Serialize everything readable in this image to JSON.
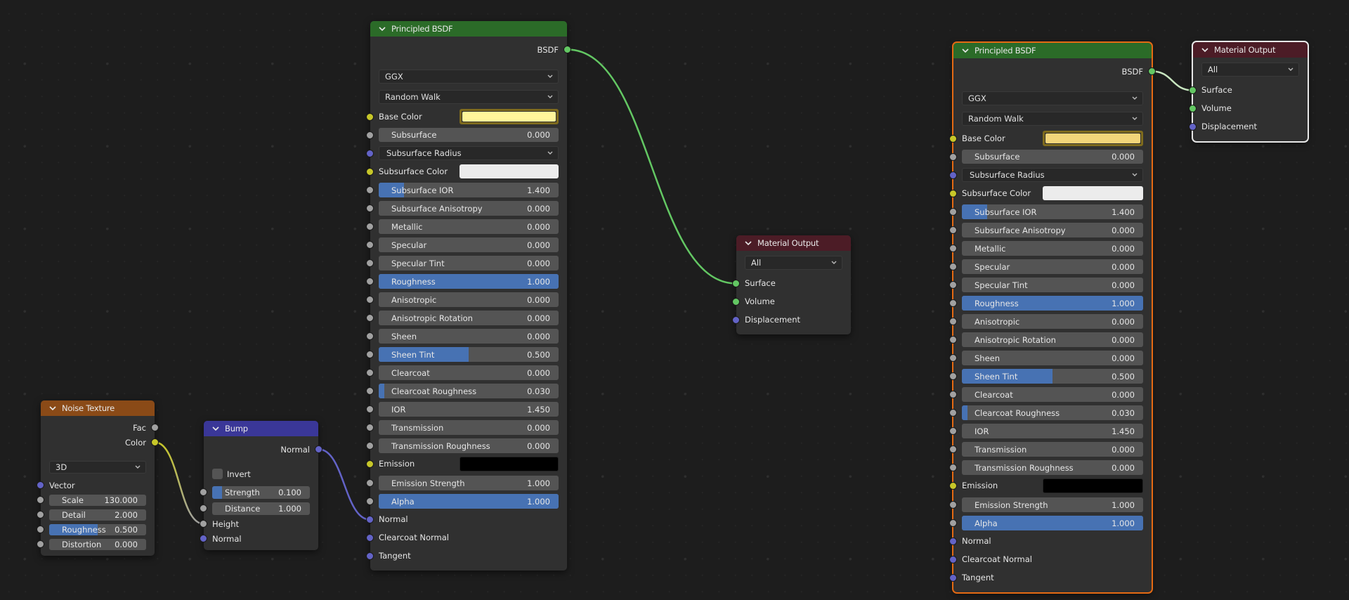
{
  "colors": {
    "background": "#1d1d1d",
    "shader_header": "#2b6b28",
    "output_header": "#4c1c26",
    "texture_header": "#8a4a17",
    "vector_header": "#3a3798",
    "slider_fill": "#4772b3",
    "link_shader": "#63c763",
    "link_vector": "#6363c7",
    "link_color": "#c7c729",
    "selected_outline": "#e56a13"
  },
  "nodes": {
    "noise": {
      "title": "Noise Texture",
      "outputs": [
        "Fac",
        "Color"
      ],
      "dimensions": "3D",
      "vector_label": "Vector",
      "fields": [
        {
          "label": "Scale",
          "value": "130.000",
          "fill": 0
        },
        {
          "label": "Detail",
          "value": "2.000",
          "fill": 0
        },
        {
          "label": "Roughness",
          "value": "0.500",
          "fill": 0.5
        },
        {
          "label": "Distortion",
          "value": "0.000",
          "fill": 0
        }
      ]
    },
    "bump": {
      "title": "Bump",
      "output": "Normal",
      "invert_label": "Invert",
      "invert_checked": false,
      "fields": [
        {
          "label": "Strength",
          "value": "0.100",
          "fill": 0.1
        },
        {
          "label": "Distance",
          "value": "1.000",
          "fill": 0
        }
      ],
      "inputs": [
        "Height",
        "Normal"
      ]
    },
    "bsdf_left": {
      "title": "Principled BSDF",
      "output": "BSDF",
      "distribution": "GGX",
      "subsurface_method": "Random Walk",
      "base_color_label": "Base Color",
      "base_color": "#fff59a",
      "subsurface_label": "Subsurface",
      "subsurface_value": "0.000",
      "subsurface_radius": "Subsurface Radius",
      "subsurface_color_label": "Subsurface Color",
      "subsurface_color": "#ececec",
      "fields": [
        {
          "label": "Subsurface IOR",
          "value": "1.400",
          "fill": 0.14
        },
        {
          "label": "Subsurface Anisotropy",
          "value": "0.000",
          "fill": 0
        },
        {
          "label": "Metallic",
          "value": "0.000",
          "fill": 0
        },
        {
          "label": "Specular",
          "value": "0.000",
          "fill": 0
        },
        {
          "label": "Specular Tint",
          "value": "0.000",
          "fill": 0
        },
        {
          "label": "Roughness",
          "value": "1.000",
          "fill": 1
        },
        {
          "label": "Anisotropic",
          "value": "0.000",
          "fill": 0
        },
        {
          "label": "Anisotropic Rotation",
          "value": "0.000",
          "fill": 0
        },
        {
          "label": "Sheen",
          "value": "0.000",
          "fill": 0
        },
        {
          "label": "Sheen Tint",
          "value": "0.500",
          "fill": 0.5
        },
        {
          "label": "Clearcoat",
          "value": "0.000",
          "fill": 0
        },
        {
          "label": "Clearcoat Roughness",
          "value": "0.030",
          "fill": 0.03
        },
        {
          "label": "IOR",
          "value": "1.450",
          "fill": 0
        },
        {
          "label": "Transmission",
          "value": "0.000",
          "fill": 0
        },
        {
          "label": "Transmission Roughness",
          "value": "0.000",
          "fill": 0
        }
      ],
      "emission_label": "Emission",
      "emission_color": "#000000",
      "fields2": [
        {
          "label": "Emission Strength",
          "value": "1.000",
          "fill": 0
        },
        {
          "label": "Alpha",
          "value": "1.000",
          "fill": 1
        }
      ],
      "vector_inputs": [
        "Normal",
        "Clearcoat Normal",
        "Tangent"
      ]
    },
    "bsdf_right": {
      "title": "Principled BSDF",
      "output": "BSDF",
      "distribution": "GGX",
      "subsurface_method": "Random Walk",
      "base_color_label": "Base Color",
      "base_color": "#f2d57a",
      "subsurface_label": "Subsurface",
      "subsurface_value": "0.000",
      "subsurface_radius": "Subsurface Radius",
      "subsurface_color_label": "Subsurface Color",
      "subsurface_color": "#ececec",
      "fields": [
        {
          "label": "Subsurface IOR",
          "value": "1.400",
          "fill": 0.14
        },
        {
          "label": "Subsurface Anisotropy",
          "value": "0.000",
          "fill": 0
        },
        {
          "label": "Metallic",
          "value": "0.000",
          "fill": 0
        },
        {
          "label": "Specular",
          "value": "0.000",
          "fill": 0
        },
        {
          "label": "Specular Tint",
          "value": "0.000",
          "fill": 0
        },
        {
          "label": "Roughness",
          "value": "1.000",
          "fill": 1
        },
        {
          "label": "Anisotropic",
          "value": "0.000",
          "fill": 0
        },
        {
          "label": "Anisotropic Rotation",
          "value": "0.000",
          "fill": 0
        },
        {
          "label": "Sheen",
          "value": "0.000",
          "fill": 0
        },
        {
          "label": "Sheen Tint",
          "value": "0.500",
          "fill": 0.5
        },
        {
          "label": "Clearcoat",
          "value": "0.000",
          "fill": 0
        },
        {
          "label": "Clearcoat Roughness",
          "value": "0.030",
          "fill": 0.03
        },
        {
          "label": "IOR",
          "value": "1.450",
          "fill": 0
        },
        {
          "label": "Transmission",
          "value": "0.000",
          "fill": 0
        },
        {
          "label": "Transmission Roughness",
          "value": "0.000",
          "fill": 0
        }
      ],
      "emission_label": "Emission",
      "emission_color": "#000000",
      "fields2": [
        {
          "label": "Emission Strength",
          "value": "1.000",
          "fill": 0
        },
        {
          "label": "Alpha",
          "value": "1.000",
          "fill": 1
        }
      ],
      "vector_inputs": [
        "Normal",
        "Clearcoat Normal",
        "Tangent"
      ]
    },
    "output_left": {
      "title": "Material Output",
      "target": "All",
      "inputs": [
        "Surface",
        "Volume",
        "Displacement"
      ]
    },
    "output_right": {
      "title": "Material Output",
      "target": "All",
      "inputs": [
        "Surface",
        "Volume",
        "Displacement"
      ]
    }
  }
}
